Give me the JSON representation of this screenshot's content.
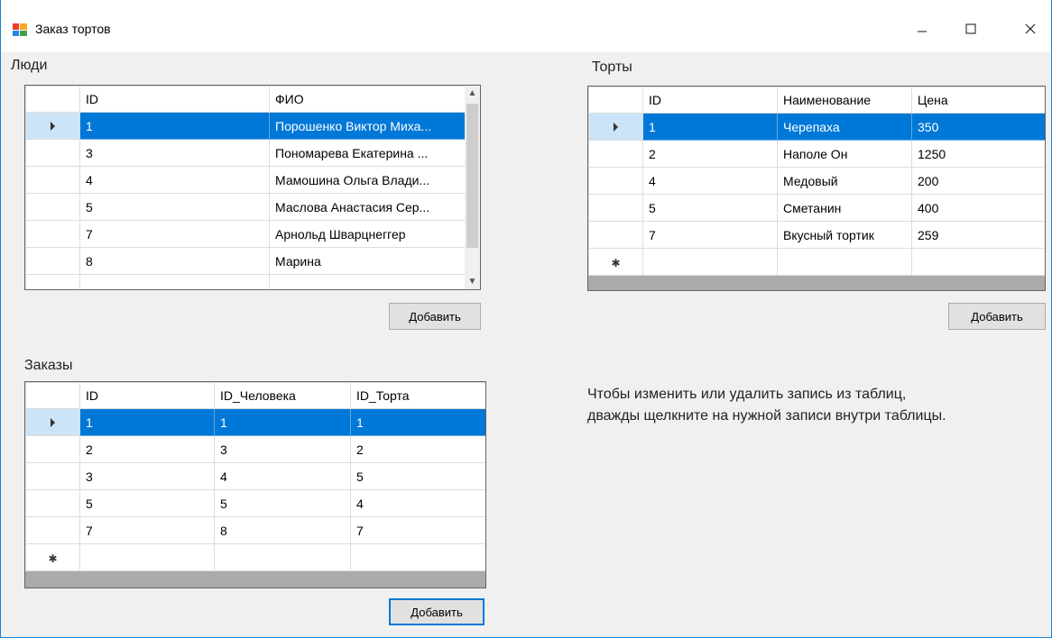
{
  "window": {
    "title": "Заказ тортов",
    "accent": "#0078d7"
  },
  "people": {
    "label": "Люди",
    "columns": [
      "ID",
      "ФИО"
    ],
    "rows": [
      {
        "id": "1",
        "name": "Порошенко Виктор Миха..."
      },
      {
        "id": "3",
        "name": "Пономарева Екатерина ..."
      },
      {
        "id": "4",
        "name": "Мамошина Ольга Влади..."
      },
      {
        "id": "5",
        "name": "Маслова Анастасия Сер..."
      },
      {
        "id": "7",
        "name": "Арнольд Шварцнеггер"
      },
      {
        "id": "8",
        "name": "Марина"
      }
    ],
    "add_label": "Добавить"
  },
  "cakes": {
    "label": "Торты",
    "columns": [
      "ID",
      "Наименование",
      "Цена"
    ],
    "rows": [
      {
        "id": "1",
        "name": "Черепаха",
        "price": "350"
      },
      {
        "id": "2",
        "name": "Наполе Он",
        "price": "1250"
      },
      {
        "id": "4",
        "name": "Медовый",
        "price": "200"
      },
      {
        "id": "5",
        "name": "Сметанин",
        "price": "400"
      },
      {
        "id": "7",
        "name": "Вкусный тортик",
        "price": "259"
      }
    ],
    "add_label": "Добавить"
  },
  "orders": {
    "label": "Заказы",
    "columns": [
      "ID",
      "ID_Человека",
      "ID_Торта"
    ],
    "rows": [
      {
        "id": "1",
        "person": "1",
        "cake": "1"
      },
      {
        "id": "2",
        "person": "3",
        "cake": "2"
      },
      {
        "id": "3",
        "person": "4",
        "cake": "5"
      },
      {
        "id": "5",
        "person": "5",
        "cake": "4"
      },
      {
        "id": "7",
        "person": "8",
        "cake": "7"
      }
    ],
    "add_label": "Добавить"
  },
  "hint": {
    "line1": "Чтобы изменить или удалить запись из таблиц,",
    "line2": "дважды щелкните на нужной записи внутри таблицы."
  },
  "icons": {
    "app": "form-app-icon",
    "minimize": "minimize-icon",
    "maximize": "maximize-icon",
    "close": "close-icon",
    "current_row": "row-pointer-icon",
    "new_row": "new-row-icon"
  }
}
